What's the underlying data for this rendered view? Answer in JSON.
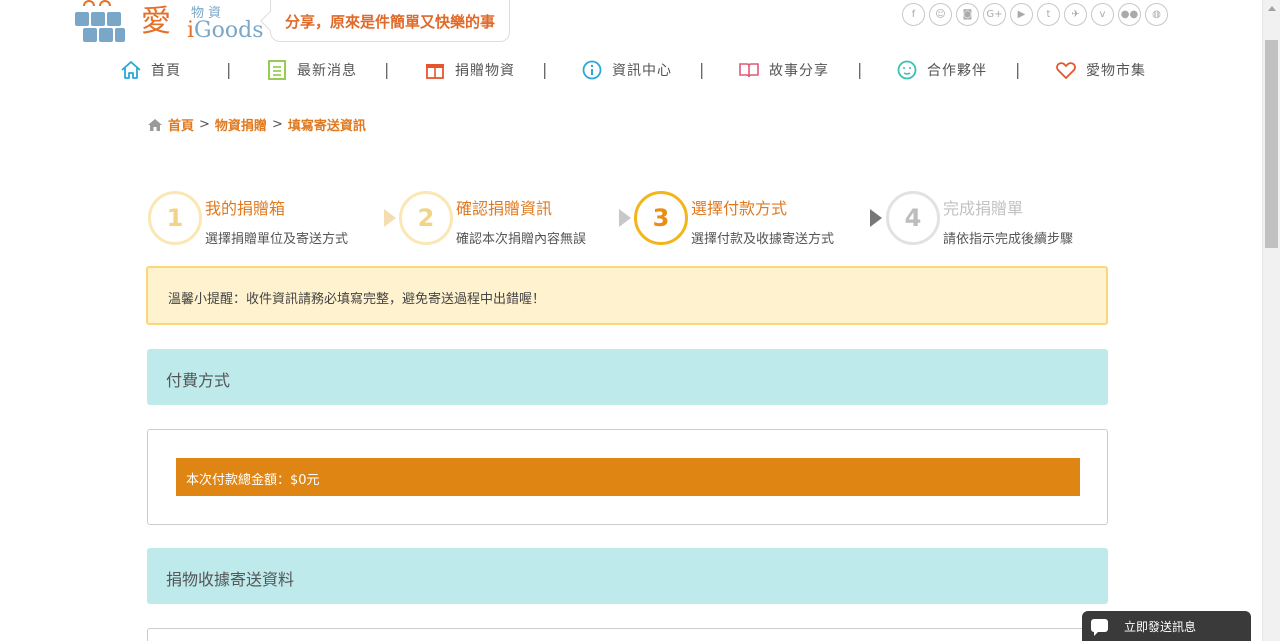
{
  "logo": {
    "ai": "愛",
    "wuzi": "物資",
    "igoods_i": "i",
    "igoods_rest": "Goods"
  },
  "slogan": "分享，原來是件簡單又快樂的事",
  "social": [
    {
      "icon": "facebook-icon",
      "glyph": "f"
    },
    {
      "icon": "line-icon",
      "glyph": "☺"
    },
    {
      "icon": "instagram-icon",
      "glyph": "◙"
    },
    {
      "icon": "googleplus-icon",
      "glyph": "G+"
    },
    {
      "icon": "youtube-icon",
      "glyph": "▶"
    },
    {
      "icon": "tumblr-icon",
      "glyph": "t"
    },
    {
      "icon": "twitter-icon",
      "glyph": "✈"
    },
    {
      "icon": "vimeo-icon",
      "glyph": "v"
    },
    {
      "icon": "flickr-icon",
      "glyph": "●●"
    },
    {
      "icon": "weibo-icon",
      "glyph": "◍"
    }
  ],
  "nav": [
    {
      "label": "首頁",
      "icon": "home-icon",
      "color": "#2aa7d9"
    },
    {
      "label": "最新消息",
      "icon": "list-icon",
      "color": "#8cc63f"
    },
    {
      "label": "捐贈物資",
      "icon": "gift-icon",
      "color": "#e5552c"
    },
    {
      "label": "資訊中心",
      "icon": "info-icon",
      "color": "#2aa7d9"
    },
    {
      "label": "故事分享",
      "icon": "book-icon",
      "color": "#e05a78"
    },
    {
      "label": "合作夥伴",
      "icon": "smile-icon",
      "color": "#3cbfae"
    },
    {
      "label": "愛物市集",
      "icon": "heart-icon",
      "color": "#e5552c"
    }
  ],
  "nav_separator": "|",
  "breadcrumb": {
    "items": [
      "首頁",
      "物資捐贈",
      "填寫寄送資訊"
    ],
    "separator": ">"
  },
  "steps": [
    {
      "number": "1",
      "title": "我的捐贈箱",
      "desc": "選擇捐贈單位及寄送方式",
      "state": "done"
    },
    {
      "number": "2",
      "title": "確認捐贈資訊",
      "desc": "確認本次捐贈內容無誤",
      "state": "done"
    },
    {
      "number": "3",
      "title": "選擇付款方式",
      "desc": "選擇付款及收據寄送方式",
      "state": "active"
    },
    {
      "number": "4",
      "title": "完成捐贈單",
      "desc": "請依指示完成後續步驟",
      "state": "future"
    }
  ],
  "notice": "溫馨小提醒：收件資訊請務必填寫完整，避免寄送過程中出錯喔！",
  "payment_section": {
    "title": "付費方式",
    "total_label": "本次付款總金額：$0元"
  },
  "receipt_section": {
    "title": "捐物收據寄送資料"
  },
  "chat": {
    "label": "立即發送訊息"
  },
  "colors": {
    "accent": "#e07a21",
    "section_bg": "#bfeaec",
    "notice_bg": "#fff2ce",
    "total_bar": "#df8514"
  }
}
